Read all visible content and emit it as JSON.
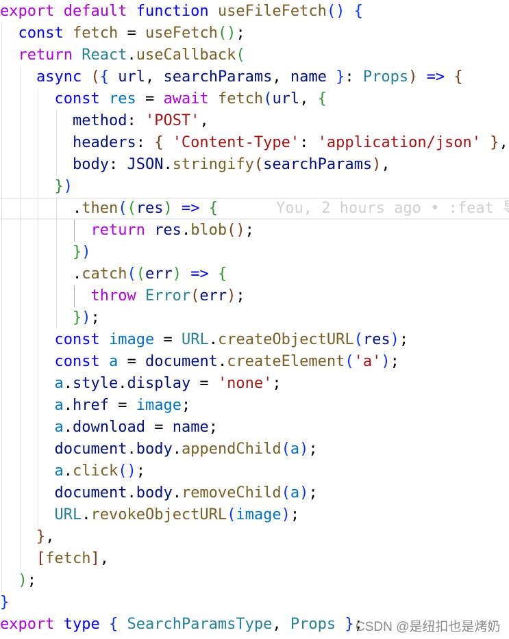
{
  "editor": {
    "lines": [
      {
        "indent": 0,
        "tokens": [
          [
            "k",
            "export"
          ],
          [
            "p",
            " "
          ],
          [
            "k",
            "default"
          ],
          [
            "p",
            " "
          ],
          [
            "s",
            "function"
          ],
          [
            "p",
            " "
          ],
          [
            "f",
            "useFileFetch"
          ],
          [
            "b0",
            "()"
          ],
          [
            "p",
            " "
          ],
          [
            "b0",
            "{"
          ]
        ]
      },
      {
        "indent": 2,
        "tokens": [
          [
            "s",
            "const"
          ],
          [
            "p",
            " "
          ],
          [
            "f",
            "fetch"
          ],
          [
            "p",
            " = "
          ],
          [
            "f",
            "useFetch"
          ],
          [
            "b1",
            "()"
          ],
          [
            "p",
            ";"
          ]
        ]
      },
      {
        "indent": 2,
        "tokens": [
          [
            "k",
            "return"
          ],
          [
            "p",
            " "
          ],
          [
            "t",
            "React"
          ],
          [
            "p",
            "."
          ],
          [
            "f",
            "useCallback"
          ],
          [
            "b1",
            "("
          ]
        ]
      },
      {
        "indent": 4,
        "tokens": [
          [
            "s",
            "async"
          ],
          [
            "p",
            " "
          ],
          [
            "b2",
            "("
          ],
          [
            "b0",
            "{"
          ],
          [
            "p",
            " "
          ],
          [
            "v",
            "url"
          ],
          [
            "p",
            ", "
          ],
          [
            "v",
            "searchParams"
          ],
          [
            "p",
            ", "
          ],
          [
            "v",
            "name"
          ],
          [
            "p",
            " "
          ],
          [
            "b0",
            "}"
          ],
          [
            "p",
            ": "
          ],
          [
            "t",
            "Props"
          ],
          [
            "b2",
            ")"
          ],
          [
            "p",
            " "
          ],
          [
            "s",
            "=>"
          ],
          [
            "p",
            " "
          ],
          [
            "b2",
            "{"
          ]
        ]
      },
      {
        "indent": 6,
        "tokens": [
          [
            "s",
            "const"
          ],
          [
            "p",
            " "
          ],
          [
            "c",
            "res"
          ],
          [
            "p",
            " = "
          ],
          [
            "k",
            "await"
          ],
          [
            "p",
            " "
          ],
          [
            "f",
            "fetch"
          ],
          [
            "b0",
            "("
          ],
          [
            "v",
            "url"
          ],
          [
            "p",
            ", "
          ],
          [
            "b1",
            "{"
          ]
        ]
      },
      {
        "indent": 8,
        "tokens": [
          [
            "v",
            "method"
          ],
          [
            "p",
            ": "
          ],
          [
            "str",
            "'POST'"
          ],
          [
            "p",
            ","
          ]
        ]
      },
      {
        "indent": 8,
        "tokens": [
          [
            "v",
            "headers"
          ],
          [
            "p",
            ": "
          ],
          [
            "b2",
            "{"
          ],
          [
            "p",
            " "
          ],
          [
            "str",
            "'Content-Type'"
          ],
          [
            "p",
            ": "
          ],
          [
            "str",
            "'application/json'"
          ],
          [
            "p",
            " "
          ],
          [
            "b2",
            "}"
          ],
          [
            "p",
            ","
          ]
        ]
      },
      {
        "indent": 8,
        "tokens": [
          [
            "v",
            "body"
          ],
          [
            "p",
            ": "
          ],
          [
            "v",
            "JSON"
          ],
          [
            "p",
            "."
          ],
          [
            "f",
            "stringify"
          ],
          [
            "b2",
            "("
          ],
          [
            "v",
            "searchParams"
          ],
          [
            "b2",
            ")"
          ],
          [
            "p",
            ","
          ]
        ]
      },
      {
        "indent": 6,
        "tokens": [
          [
            "b1",
            "}"
          ],
          [
            "b0",
            ")"
          ]
        ]
      },
      {
        "indent": 8,
        "current": true,
        "blame": "You, 2 hours ago • :feat 导",
        "tokens": [
          [
            "p",
            "."
          ],
          [
            "f",
            "then"
          ],
          [
            "b0",
            "("
          ],
          [
            "b1",
            "("
          ],
          [
            "v",
            "res"
          ],
          [
            "b1",
            ")"
          ],
          [
            "p",
            " "
          ],
          [
            "s",
            "=>"
          ],
          [
            "p",
            " "
          ],
          [
            "b1",
            "{"
          ]
        ]
      },
      {
        "indent": 10,
        "active": true,
        "tokens": [
          [
            "k",
            "return"
          ],
          [
            "p",
            " "
          ],
          [
            "v",
            "res"
          ],
          [
            "p",
            "."
          ],
          [
            "f",
            "blob"
          ],
          [
            "b2",
            "()"
          ],
          [
            "p",
            ";"
          ]
        ]
      },
      {
        "indent": 8,
        "tokens": [
          [
            "b1",
            "}"
          ],
          [
            "b0",
            ")"
          ]
        ]
      },
      {
        "indent": 8,
        "tokens": [
          [
            "p",
            "."
          ],
          [
            "f",
            "catch"
          ],
          [
            "b0",
            "("
          ],
          [
            "b1",
            "("
          ],
          [
            "v",
            "err"
          ],
          [
            "b1",
            ")"
          ],
          [
            "p",
            " "
          ],
          [
            "s",
            "=>"
          ],
          [
            "p",
            " "
          ],
          [
            "b1",
            "{"
          ]
        ]
      },
      {
        "indent": 10,
        "active": true,
        "tokens": [
          [
            "k",
            "throw"
          ],
          [
            "p",
            " "
          ],
          [
            "t",
            "Error"
          ],
          [
            "b2",
            "("
          ],
          [
            "v",
            "err"
          ],
          [
            "b2",
            ")"
          ],
          [
            "p",
            ";"
          ]
        ]
      },
      {
        "indent": 8,
        "tokens": [
          [
            "b1",
            "}"
          ],
          [
            "b0",
            ")"
          ],
          [
            "p",
            ";"
          ]
        ]
      },
      {
        "indent": 6,
        "tokens": [
          [
            "s",
            "const"
          ],
          [
            "p",
            " "
          ],
          [
            "c",
            "image"
          ],
          [
            "p",
            " = "
          ],
          [
            "t",
            "URL"
          ],
          [
            "p",
            "."
          ],
          [
            "f",
            "createObjectURL"
          ],
          [
            "b0",
            "("
          ],
          [
            "v",
            "res"
          ],
          [
            "b0",
            ")"
          ],
          [
            "p",
            ";"
          ]
        ]
      },
      {
        "indent": 6,
        "tokens": [
          [
            "s",
            "const"
          ],
          [
            "p",
            " "
          ],
          [
            "c",
            "a"
          ],
          [
            "p",
            " = "
          ],
          [
            "v",
            "document"
          ],
          [
            "p",
            "."
          ],
          [
            "f",
            "createElement"
          ],
          [
            "b0",
            "("
          ],
          [
            "str",
            "'a'"
          ],
          [
            "b0",
            ")"
          ],
          [
            "p",
            ";"
          ]
        ]
      },
      {
        "indent": 6,
        "tokens": [
          [
            "c",
            "a"
          ],
          [
            "p",
            "."
          ],
          [
            "v",
            "style"
          ],
          [
            "p",
            "."
          ],
          [
            "v",
            "display"
          ],
          [
            "p",
            " = "
          ],
          [
            "str",
            "'none'"
          ],
          [
            "p",
            ";"
          ]
        ]
      },
      {
        "indent": 6,
        "tokens": [
          [
            "c",
            "a"
          ],
          [
            "p",
            "."
          ],
          [
            "v",
            "href"
          ],
          [
            "p",
            " = "
          ],
          [
            "c",
            "image"
          ],
          [
            "p",
            ";"
          ]
        ]
      },
      {
        "indent": 6,
        "tokens": [
          [
            "c",
            "a"
          ],
          [
            "p",
            "."
          ],
          [
            "v",
            "download"
          ],
          [
            "p",
            " = "
          ],
          [
            "v",
            "name"
          ],
          [
            "p",
            ";"
          ]
        ]
      },
      {
        "indent": 6,
        "tokens": [
          [
            "v",
            "document"
          ],
          [
            "p",
            "."
          ],
          [
            "v",
            "body"
          ],
          [
            "p",
            "."
          ],
          [
            "f",
            "appendChild"
          ],
          [
            "b0",
            "("
          ],
          [
            "c",
            "a"
          ],
          [
            "b0",
            ")"
          ],
          [
            "p",
            ";"
          ]
        ]
      },
      {
        "indent": 6,
        "tokens": [
          [
            "c",
            "a"
          ],
          [
            "p",
            "."
          ],
          [
            "f",
            "click"
          ],
          [
            "b0",
            "()"
          ],
          [
            "p",
            ";"
          ]
        ]
      },
      {
        "indent": 6,
        "tokens": [
          [
            "v",
            "document"
          ],
          [
            "p",
            "."
          ],
          [
            "v",
            "body"
          ],
          [
            "p",
            "."
          ],
          [
            "f",
            "removeChild"
          ],
          [
            "b0",
            "("
          ],
          [
            "c",
            "a"
          ],
          [
            "b0",
            ")"
          ],
          [
            "p",
            ";"
          ]
        ]
      },
      {
        "indent": 6,
        "tokens": [
          [
            "t",
            "URL"
          ],
          [
            "p",
            "."
          ],
          [
            "f",
            "revokeObjectURL"
          ],
          [
            "b0",
            "("
          ],
          [
            "c",
            "image"
          ],
          [
            "b0",
            ")"
          ],
          [
            "p",
            ";"
          ]
        ]
      },
      {
        "indent": 4,
        "tokens": [
          [
            "b2",
            "}"
          ],
          [
            "p",
            ","
          ]
        ]
      },
      {
        "indent": 4,
        "tokens": [
          [
            "b2",
            "["
          ],
          [
            "f",
            "fetch"
          ],
          [
            "b2",
            "]"
          ],
          [
            "p",
            ","
          ]
        ]
      },
      {
        "indent": 2,
        "tokens": [
          [
            "b1",
            ")"
          ],
          [
            "p",
            ";"
          ]
        ]
      },
      {
        "indent": 0,
        "tokens": [
          [
            "b0",
            "}"
          ]
        ]
      },
      {
        "indent": 0,
        "tokens": [
          [
            "k",
            "export"
          ],
          [
            "p",
            " "
          ],
          [
            "s",
            "type"
          ],
          [
            "p",
            " "
          ],
          [
            "b0",
            "{"
          ],
          [
            "p",
            " "
          ],
          [
            "t",
            "SearchParamsType"
          ],
          [
            "p",
            ", "
          ],
          [
            "t",
            "Props"
          ],
          [
            "p",
            " "
          ],
          [
            "b0",
            "}"
          ],
          [
            "p",
            ";"
          ]
        ]
      }
    ]
  },
  "watermark": "CSDN @是纽扣也是烤奶"
}
